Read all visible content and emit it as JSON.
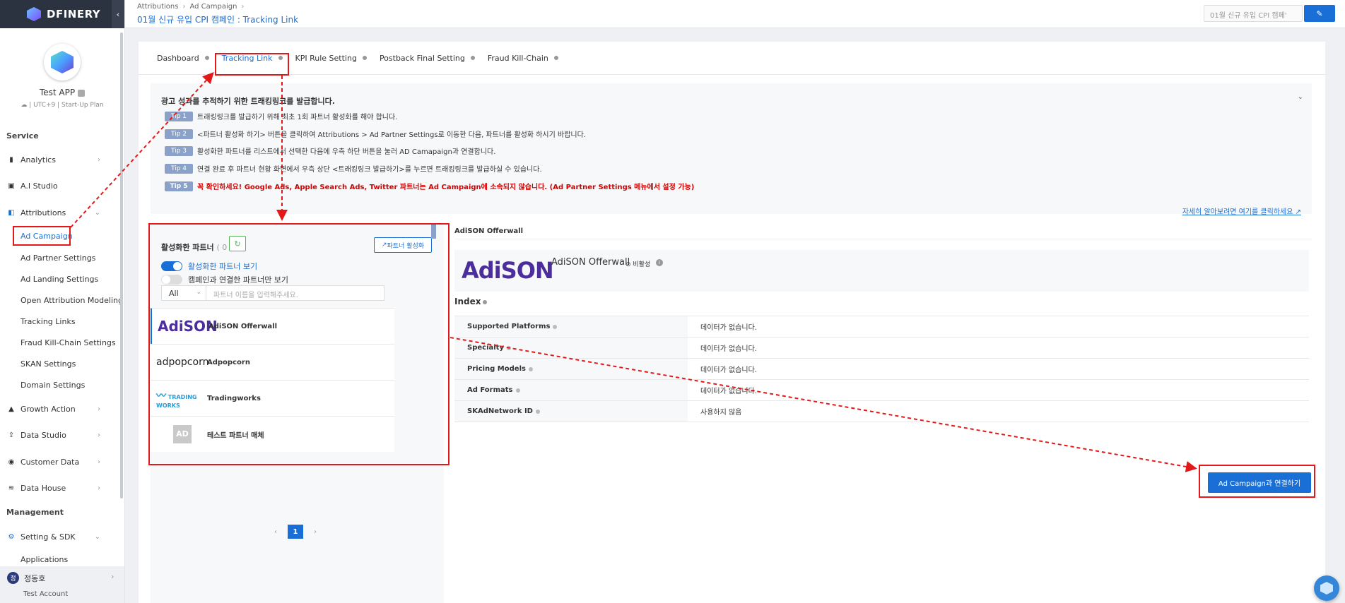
{
  "brand": {
    "name": "DFINERY"
  },
  "app": {
    "name": "Test APP",
    "meta": "UTC+9 | Start-Up Plan"
  },
  "sidebar": {
    "service_title": "Service",
    "management_title": "Management",
    "items": [
      {
        "label": "Analytics"
      },
      {
        "label": "A.I Studio"
      },
      {
        "label": "Attributions"
      },
      {
        "label": "Growth Action"
      },
      {
        "label": "Data Studio"
      },
      {
        "label": "Customer Data"
      },
      {
        "label": "Data House"
      },
      {
        "label": "Setting & SDK"
      }
    ],
    "attributions_sub": [
      "Ad Campaign",
      "Ad Partner Settings",
      "Ad Landing Settings",
      "Open Attribution Modeling",
      "Tracking Links",
      "Fraud Kill-Chain Settings",
      "SKAN Settings",
      "Domain Settings"
    ],
    "setting_sub": [
      "Applications"
    ],
    "user": {
      "initial": "정",
      "name": "정동호",
      "account": "Test Account"
    }
  },
  "header": {
    "breadcrumb": [
      "Attributions",
      "Ad Campaign"
    ],
    "title": "01월 신규 유입 CPI 캠페인 : Tracking Link",
    "input_value": "01월 신규 유입 CPI 캠페'"
  },
  "tabs": [
    {
      "label": "Dashboard"
    },
    {
      "label": "Tracking Link"
    },
    {
      "label": "KPI Rule Setting"
    },
    {
      "label": "Postback Final Setting"
    },
    {
      "label": "Fraud Kill-Chain"
    }
  ],
  "info": {
    "title": "광고 성과를 추적하기 위한 트래킹링크를 발급합니다.",
    "tips": [
      {
        "badge": "Tip 1",
        "text": "트래킹링크를 발급하기 위해 최초 1회 파트너 활성화를 해야 합니다."
      },
      {
        "badge": "Tip 2",
        "text": "<파트너 활성화 하기> 버튼을 클릭하여 Attributions > Ad Partner Settings로 이동한 다음, 파트너를 활성화 하시기 바랍니다."
      },
      {
        "badge": "Tip 3",
        "text": "활성화한 파트너를 리스트에서 선택한 다음에 우측 하단 버튼을 눌러 AD Camapaign과 연결합니다."
      },
      {
        "badge": "Tip 4",
        "text": "연결 완료 후 파트너 현황 화면에서 우측 상단 <트래킹링크 발급하기>를 누르면 트래킹링크를 발급하실 수 있습니다."
      },
      {
        "badge": "Tip 5",
        "text": "꼭 확인하세요! Google Ads, Apple Search Ads, Twitter 파트너는 Ad Campaign에 소속되지 않습니다. (Ad Partner Settings 메뉴에서 설정 가능)"
      }
    ],
    "link": "자세히 알아보려면 여기를 클릭하세요"
  },
  "partners_panel": {
    "title": "활성화한 파트너",
    "count": "( 0 )",
    "activate_label": "파트너 활성화",
    "toggle_active": "활성화한 파트너 보기",
    "toggle_linked": "캠페인과 연결한 파트너만 보기",
    "filter_value": "All",
    "search_placeholder": "파트너 이름을 입력해주세요.",
    "partners": [
      {
        "logo": "AdiSON",
        "name": "AdiSON Offerwall"
      },
      {
        "logo": "adpopcorn",
        "name": "Adpopcorn"
      },
      {
        "logo": "TRADING WORKS",
        "name": "Tradingworks"
      },
      {
        "logo": "AD",
        "name": "테스트 파트너 매체"
      }
    ],
    "page": "1"
  },
  "detail": {
    "header": "AdiSON Offerwall",
    "logo": "AdiSON",
    "name": "AdiSON Offerwall",
    "status": "비활성",
    "index_title": "Index",
    "rows": [
      {
        "key": "Supported Platforms",
        "value": "데이터가 없습니다."
      },
      {
        "key": "Specialty",
        "value": "데이터가 없습니다."
      },
      {
        "key": "Pricing Models",
        "value": "데이터가 없습니다."
      },
      {
        "key": "Ad Formats",
        "value": "데이터가 없습니다."
      },
      {
        "key": "SKAdNetwork ID",
        "value": "사용하지 않음"
      }
    ],
    "connect_label": "Ad Campaign과 연결하기"
  },
  "colors": {
    "accent": "#1a6fd6",
    "highlight": "#e31818",
    "sidebar_dark": "#2b3240"
  }
}
